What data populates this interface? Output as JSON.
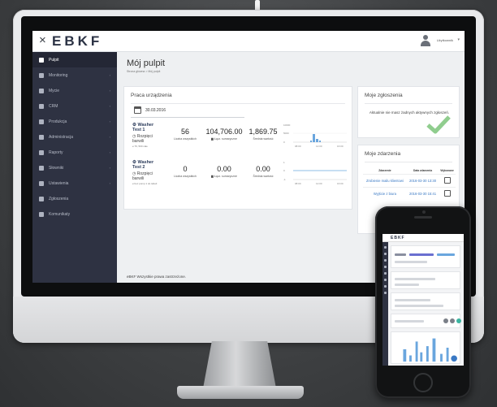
{
  "app": {
    "close_glyph": "×",
    "logo": "EBKF",
    "user_name": "Użytkownik",
    "user_caret": "▾"
  },
  "sidebar": {
    "items": [
      {
        "label": "Pulpit",
        "icon": "dashboard-icon",
        "active": true,
        "has_caret": false
      },
      {
        "label": "Monitoring",
        "icon": "chart-icon",
        "active": false,
        "has_caret": true
      },
      {
        "label": "Mycie",
        "icon": "washing-icon",
        "active": false,
        "has_caret": true
      },
      {
        "label": "CRM",
        "icon": "handshake-icon",
        "active": false,
        "has_caret": true
      },
      {
        "label": "Produkcja",
        "icon": "gear-icon",
        "active": false,
        "has_caret": true
      },
      {
        "label": "Administracja",
        "icon": "monitor-icon",
        "active": false,
        "has_caret": true
      },
      {
        "label": "Raporty",
        "icon": "report-icon",
        "active": false,
        "has_caret": true
      },
      {
        "label": "Słowniki",
        "icon": "book-icon",
        "active": false,
        "has_caret": true
      },
      {
        "label": "Ustawienia",
        "icon": "wrench-icon",
        "active": false,
        "has_caret": true
      },
      {
        "label": "Zgłoszenia",
        "icon": "bell-icon",
        "active": false,
        "has_caret": false
      },
      {
        "label": "Komunikaty",
        "icon": "message-icon",
        "active": false,
        "has_caret": false
      }
    ]
  },
  "page": {
    "title": "Mój pulpit",
    "breadcrumb": "Strona główna > Mój pulpit"
  },
  "work_card": {
    "title": "Praca urządzenia",
    "date": "30.03.2016",
    "devices": [
      {
        "name_line1": "Washer",
        "name_line2": "Test 1",
        "status_line1": "Rozpięci",
        "status_line2": "barwili",
        "small": "≥ 76, 500 cale",
        "stats": [
          {
            "value": "56",
            "label": "Liczba wszystkich"
          },
          {
            "value": "104,706.00",
            "label": "Łącz. sumaryczne"
          },
          {
            "value": "1,869.75",
            "label": "Średnia wartość"
          }
        ],
        "chart_axis": [
          "5000",
          "10000",
          "0"
        ],
        "chart_ticks": [
          "08:00",
          "12:00",
          "16:00"
        ]
      },
      {
        "name_line1": "Washer",
        "name_line2": "Test 2",
        "status_line1": "Rozpięci",
        "status_line2": "barwili",
        "small": "≥ bez pomp 1 do tabeli",
        "stats": [
          {
            "value": "0",
            "label": "Liczba wszystkich"
          },
          {
            "value": "0.00",
            "label": "Łącz. sumaryczne"
          },
          {
            "value": "0.00",
            "label": "Średnia wartość"
          }
        ],
        "chart_axis": [
          "1",
          "0",
          "-1"
        ],
        "chart_ticks": [
          "08:00",
          "12:00",
          "16:00"
        ]
      }
    ]
  },
  "tasks_card": {
    "title": "Moje zgłoszenia",
    "message": "Aktualnie nie masz żadnych aktywnych zgłoszeń."
  },
  "events_card": {
    "title": "Moje zdarzenia",
    "headers": [
      "Zdarzenie",
      "Data zdarzenia",
      "Wykonane"
    ],
    "rows": [
      {
        "event": "Zrobienie mailu klientowi",
        "date": "2016-03-30 13:30"
      },
      {
        "event": "Wyjście z biura",
        "date": "2016-03-30 15:41"
      }
    ]
  },
  "footer": {
    "text": "eBKF Wszystkie prawa zastrzeżone."
  },
  "phone": {
    "logo": "EBKF"
  },
  "colors": {
    "sidebar": "#2e3242",
    "accent_link": "#3a79c4",
    "check_green": "#7cc47a",
    "chart_blue": "#6aa6de"
  }
}
